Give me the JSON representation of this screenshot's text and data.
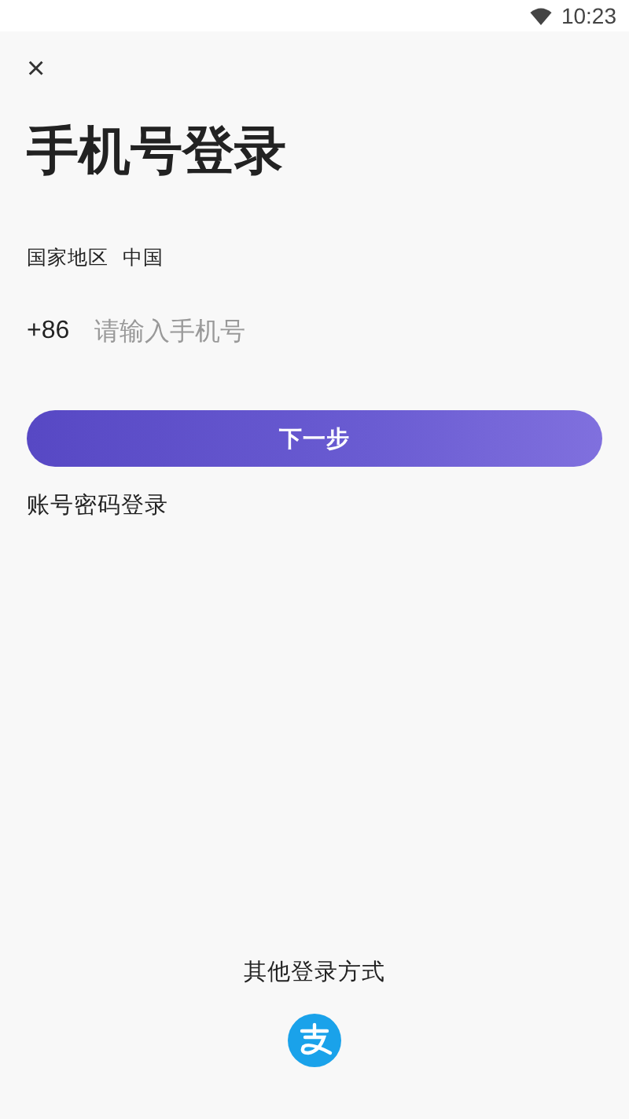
{
  "status_bar": {
    "time": "10:23"
  },
  "close": "×",
  "title": "手机号登录",
  "region": {
    "label": "国家地区",
    "value": "中国"
  },
  "phone": {
    "prefix": "+86",
    "placeholder": "请输入手机号"
  },
  "next_button": "下一步",
  "password_login": "账号密码登录",
  "other_login": {
    "label": "其他登录方式"
  }
}
